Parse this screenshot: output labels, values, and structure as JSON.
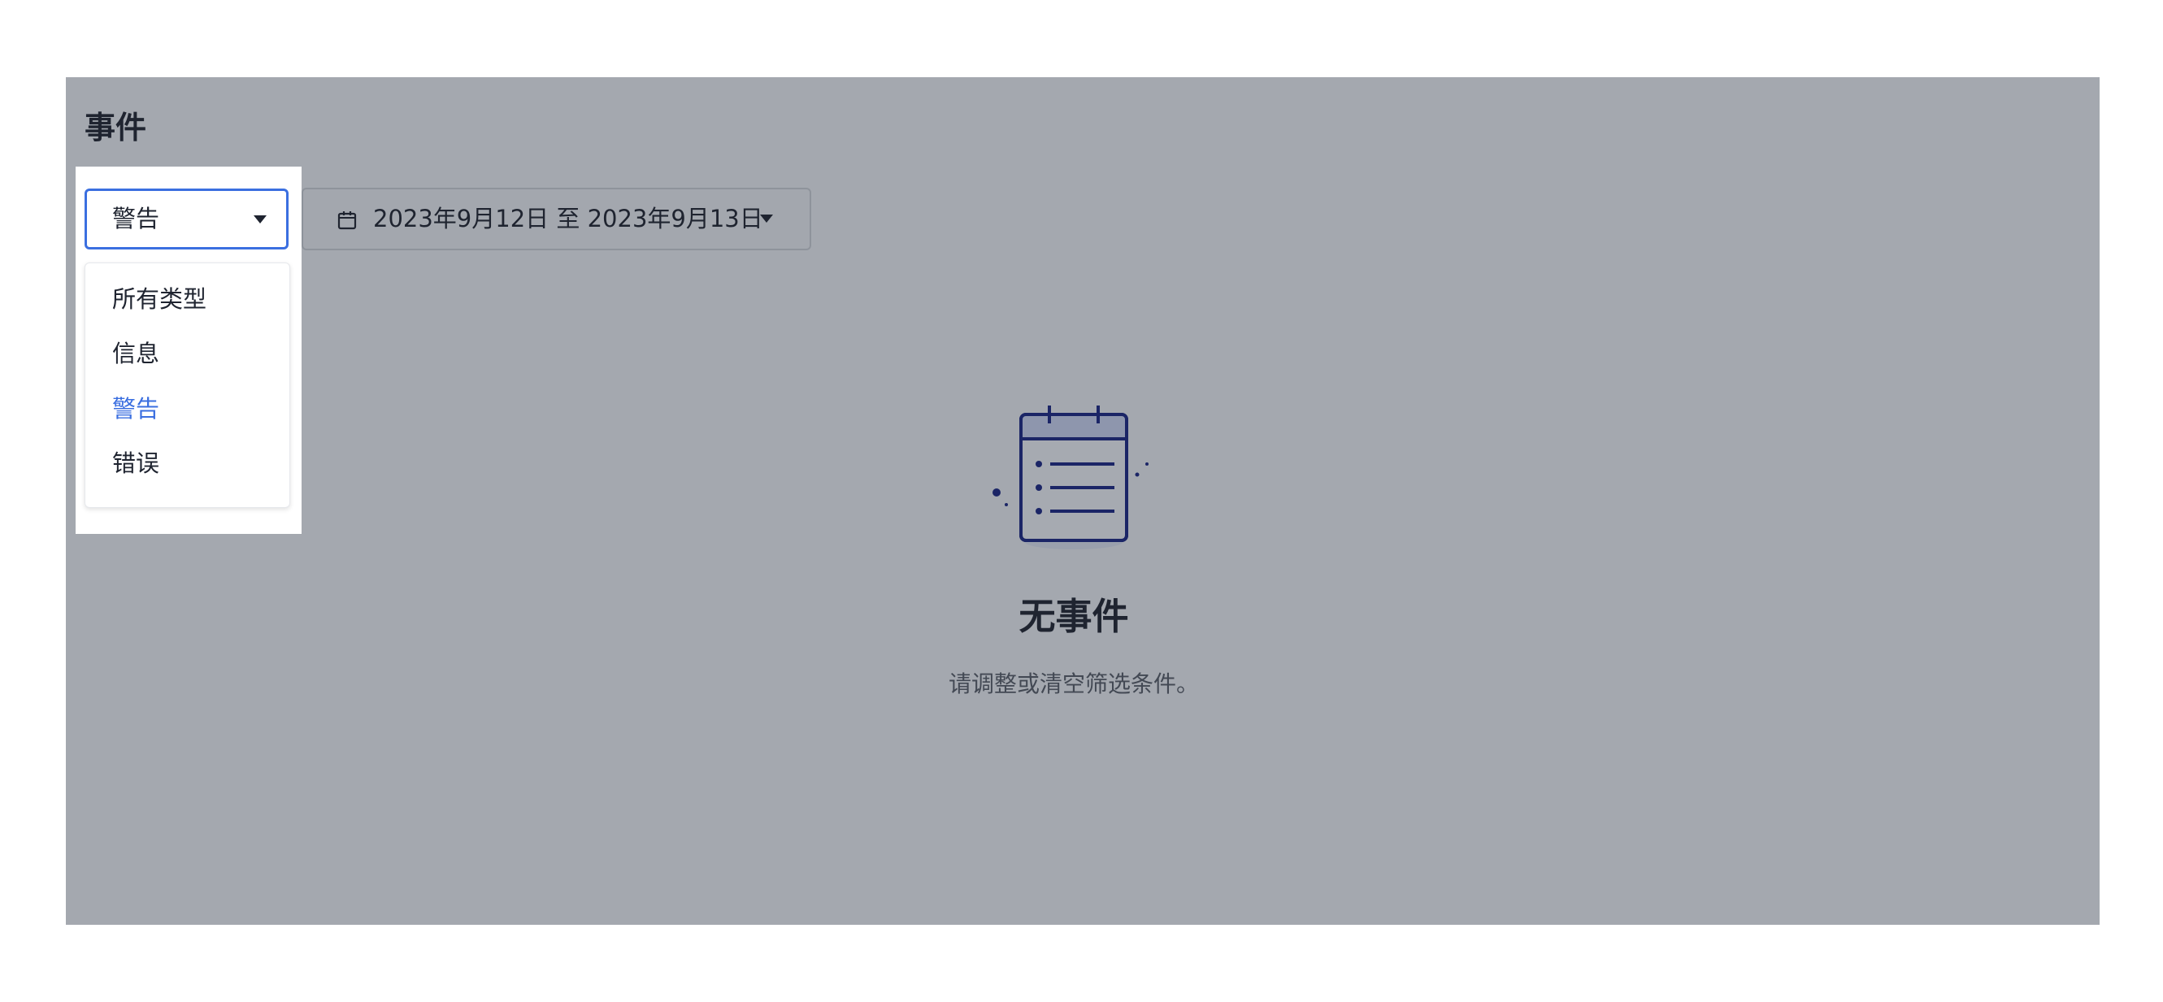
{
  "page": {
    "title": "事件"
  },
  "filters": {
    "type_select": {
      "value": "警告",
      "options": [
        "所有类型",
        "信息",
        "警告",
        "错误"
      ],
      "selected_index": 2
    },
    "date_range": {
      "label": "2023年9月12日 至 2023年9月13日"
    }
  },
  "empty_state": {
    "title": "无事件",
    "description": "请调整或清空筛选条件。"
  },
  "icons": {
    "type_caret": "chevron-down-icon",
    "date": "calendar-icon",
    "date_caret": "chevron-down-icon",
    "empty": "calendar-list-icon"
  },
  "colors": {
    "accent": "#3b6fe0",
    "overlay": "#a4a8af",
    "text": "#1f2430",
    "illustration": "#1b2566"
  }
}
